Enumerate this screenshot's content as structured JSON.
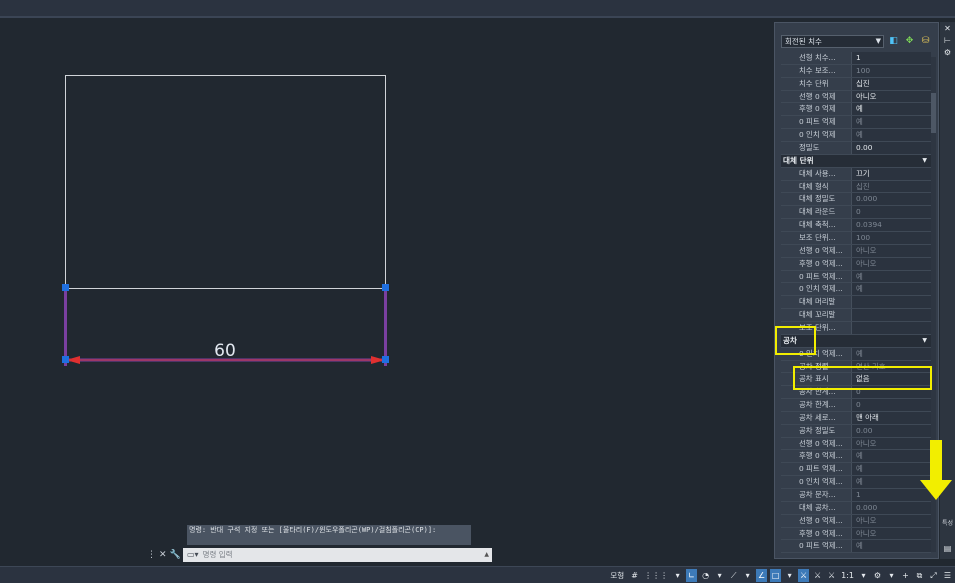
{
  "drawing": {
    "dimension_text": "60"
  },
  "properties": {
    "dropdown_value": "회전된 치수",
    "rows_top": [
      {
        "k": "선형 치수...",
        "v": "1",
        "dim": false
      },
      {
        "k": "치수 보조...",
        "v": "100",
        "dim": true
      },
      {
        "k": "치수 단위",
        "v": "십진",
        "dim": false
      },
      {
        "k": "선행 0 억제",
        "v": "아니오",
        "dim": false
      },
      {
        "k": "후행 0 억제",
        "v": "예",
        "dim": false
      },
      {
        "k": "0 피트 억제",
        "v": "예",
        "dim": true
      },
      {
        "k": "0 인치 억제",
        "v": "예",
        "dim": true
      },
      {
        "k": "정밀도",
        "v": "0.00",
        "dim": false
      }
    ],
    "section_alt": "대체 단위",
    "rows_alt": [
      {
        "k": "대체 사용...",
        "v": "끄기",
        "dim": false
      },
      {
        "k": "대체 형식",
        "v": "십진",
        "dim": true
      },
      {
        "k": "대체 정밀도",
        "v": "0.000",
        "dim": true
      },
      {
        "k": "대체 라운드",
        "v": "0",
        "dim": true
      },
      {
        "k": "대체 축척...",
        "v": "0.0394",
        "dim": true
      },
      {
        "k": "보조 단위...",
        "v": "100",
        "dim": true
      },
      {
        "k": "선행 0 억제...",
        "v": "아니오",
        "dim": true
      },
      {
        "k": "후행 0 억제...",
        "v": "아니오",
        "dim": true
      },
      {
        "k": "0 피트 억제...",
        "v": "예",
        "dim": true
      },
      {
        "k": "0 인치 억제...",
        "v": "예",
        "dim": true
      },
      {
        "k": "대체 머리말",
        "v": "",
        "dim": true
      },
      {
        "k": "대체 꼬리말",
        "v": "",
        "dim": true
      },
      {
        "k": "보조 단위...",
        "v": "",
        "dim": true
      }
    ],
    "section_tol": "공차",
    "rows_tol": [
      {
        "k": "0 인치 억제...",
        "v": "예",
        "dim": true
      },
      {
        "k": "공차 정렬",
        "v": "연산 기호",
        "dim": true
      },
      {
        "k": "공차 표시",
        "v": "없음",
        "dim": false
      },
      {
        "k": "공차 한계...",
        "v": "0",
        "dim": true
      },
      {
        "k": "공차 한계...",
        "v": "0",
        "dim": true
      },
      {
        "k": "공차 세로...",
        "v": "맨 아래",
        "dim": false
      },
      {
        "k": "공차 정밀도",
        "v": "0.00",
        "dim": true
      },
      {
        "k": "선행 0 억제...",
        "v": "아니오",
        "dim": true
      },
      {
        "k": "후행 0 억제...",
        "v": "예",
        "dim": true
      },
      {
        "k": "0 피트 억제...",
        "v": "예",
        "dim": true
      },
      {
        "k": "0 인치 억제...",
        "v": "예",
        "dim": true
      },
      {
        "k": "공차 문자...",
        "v": "1",
        "dim": true
      },
      {
        "k": "대체 공차...",
        "v": "0.000",
        "dim": true
      },
      {
        "k": "선행 0 억제...",
        "v": "아니오",
        "dim": true
      },
      {
        "k": "후행 0 억제...",
        "v": "아니오",
        "dim": true
      },
      {
        "k": "0 피트 억제...",
        "v": "예",
        "dim": true
      }
    ]
  },
  "side_strip": {
    "vertical_label": "특성"
  },
  "command": {
    "history": "명령: 반대 구석 지정 또는 [울타리(F)/윈도우폴리곤(WP)/걸침폴리곤(CP)]:",
    "placeholder": "명령 입력"
  },
  "statusbar": {
    "model_label": "모형",
    "scale_label": "1:1"
  },
  "colors": {
    "highlight": "#f2ee00",
    "selection": "#7a3fa0",
    "grip": "#1f6fe0",
    "arrowhead": "#e03030"
  }
}
